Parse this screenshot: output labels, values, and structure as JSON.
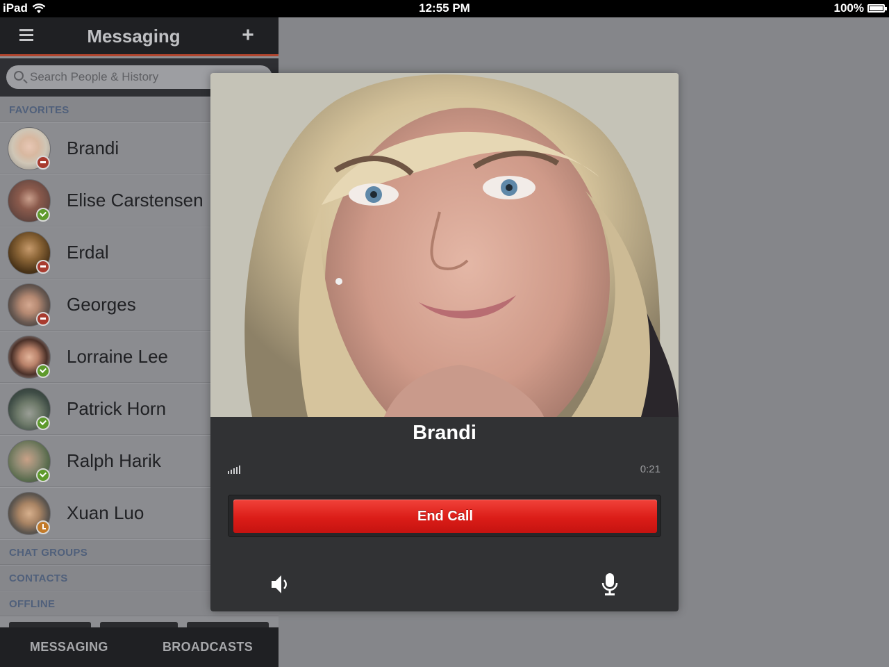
{
  "status_bar": {
    "device": "iPad",
    "time": "12:55 PM",
    "battery": "100%"
  },
  "nav": {
    "title": "Messaging"
  },
  "search": {
    "placeholder": "Search People & History"
  },
  "sections": {
    "favorites": "FAVORITES",
    "chat_groups": "CHAT GROUPS",
    "contacts": "CONTACTS",
    "offline": "OFFLINE"
  },
  "favorites": [
    {
      "name": "Brandi",
      "status": "busy"
    },
    {
      "name": "Elise Carstensen",
      "status": "online"
    },
    {
      "name": "Erdal",
      "status": "busy"
    },
    {
      "name": "Georges",
      "status": "busy"
    },
    {
      "name": "Lorraine Lee",
      "status": "online"
    },
    {
      "name": "Patrick Horn",
      "status": "online"
    },
    {
      "name": "Ralph Harik",
      "status": "online"
    },
    {
      "name": "Xuan Luo",
      "status": "away"
    }
  ],
  "bottom_tabs": {
    "messaging": "MESSAGING",
    "broadcasts": "BROADCASTS"
  },
  "call": {
    "caller": "Brandi",
    "duration": "0:21",
    "end_label": "End Call"
  },
  "icons": {
    "menu": "hamburger-icon",
    "add": "plus-icon",
    "search": "magnifier-icon",
    "speaker": "speaker-icon",
    "mic": "microphone-icon",
    "signal": "signal-strength-icon"
  },
  "colors": {
    "nav_bg": "#1f2023",
    "nav_accent": "#b2452e",
    "end_call": "#db1d18",
    "online": "#5e9a2c",
    "busy": "#a83b2f",
    "away": "#c27a2a"
  }
}
